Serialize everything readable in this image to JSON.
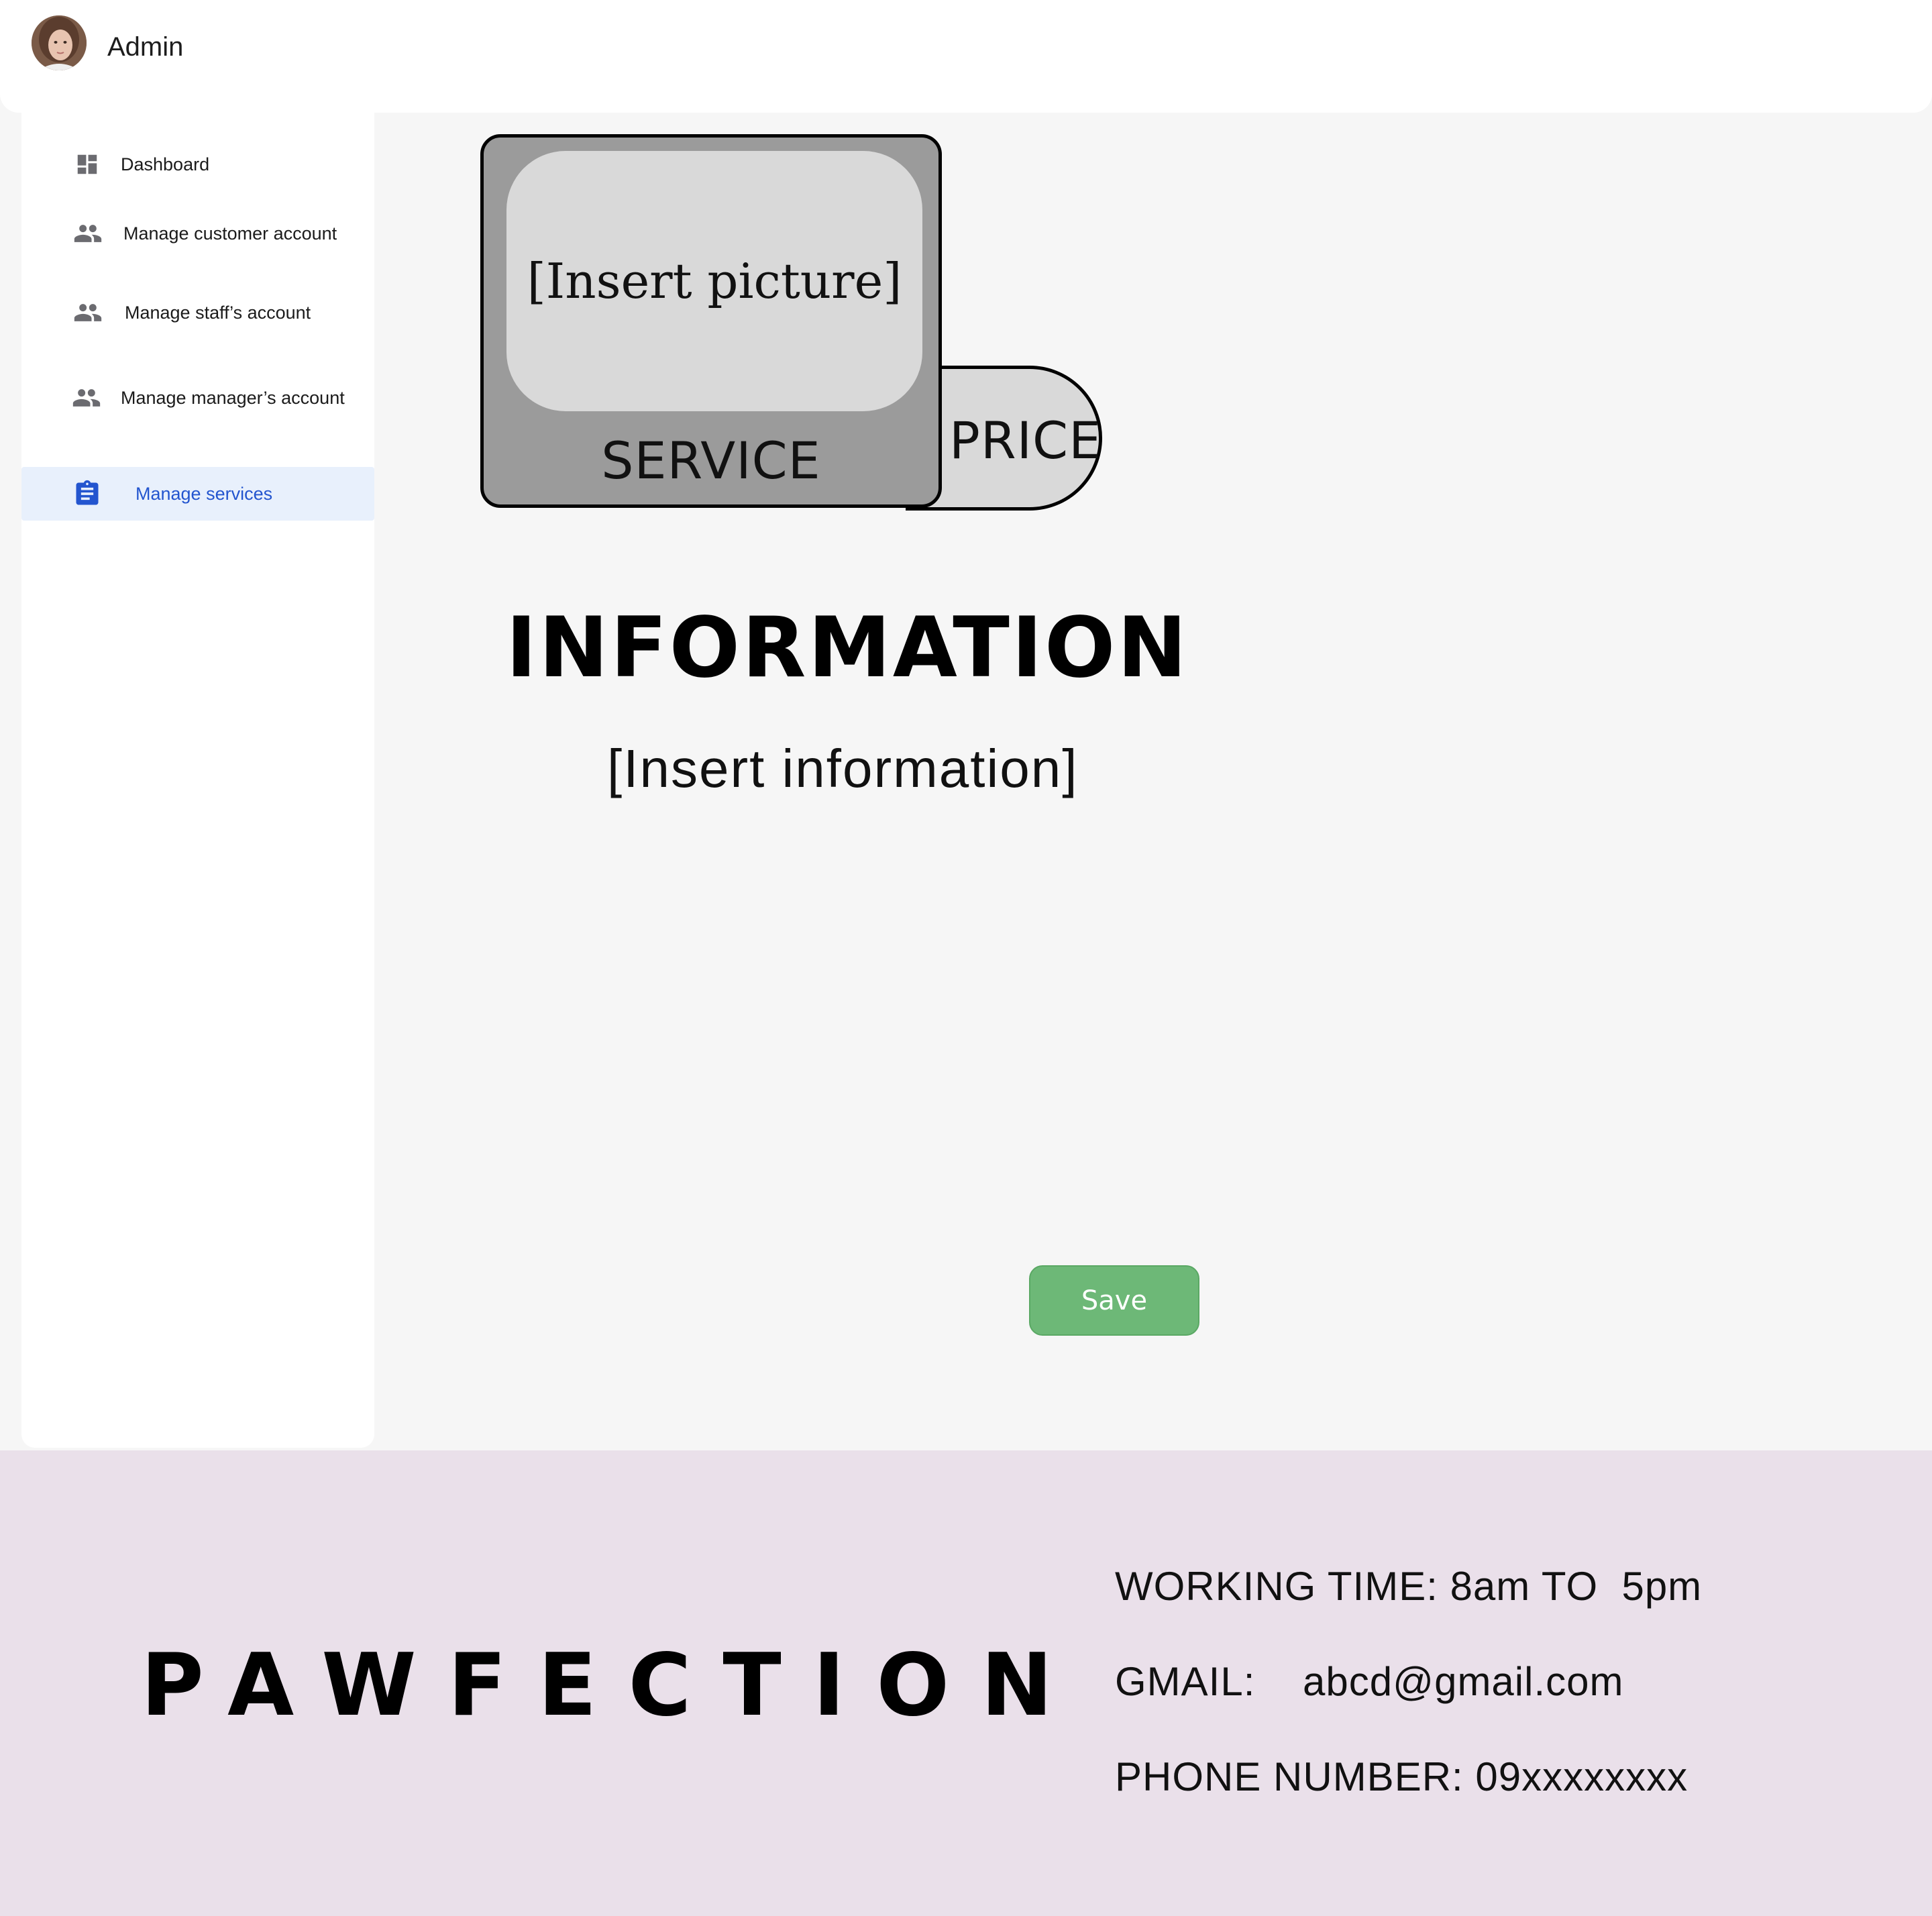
{
  "header": {
    "title": "Admin",
    "avatar_icon": "user-avatar"
  },
  "sidebar": {
    "items": [
      {
        "label": "Dashboard",
        "icon": "dashboard-icon",
        "active": false
      },
      {
        "label": "Manage customer account",
        "icon": "people-icon",
        "active": false
      },
      {
        "label": "Manage staff’s account",
        "icon": "people-icon",
        "active": false
      },
      {
        "label": "Manage manager’s account",
        "icon": "people-icon",
        "active": false
      },
      {
        "label": "Manage services",
        "icon": "clipboard-icon",
        "active": true
      }
    ]
  },
  "service_card": {
    "picture_placeholder": "[Insert picture]",
    "service_label": "SERVICE",
    "price_label": "PRICE"
  },
  "information": {
    "title": "INFORMATION",
    "body_placeholder": "[Insert information]"
  },
  "actions": {
    "save_label": "Save"
  },
  "footer": {
    "brand": "PAWFECTION",
    "working_time": "WORKING TIME: 8am TO  5pm",
    "gmail": "GMAIL:    abcd@gmail.com",
    "phone": "PHONE NUMBER: 09xxxxxxxx"
  },
  "colors": {
    "active_nav_text": "#2355cf",
    "active_nav_bg": "#e8f0fc",
    "save_button": "#6db877",
    "footer_bg": "#eae0ea",
    "card_bg": "#9b9b9b",
    "picture_bg": "#d9d9d9"
  }
}
